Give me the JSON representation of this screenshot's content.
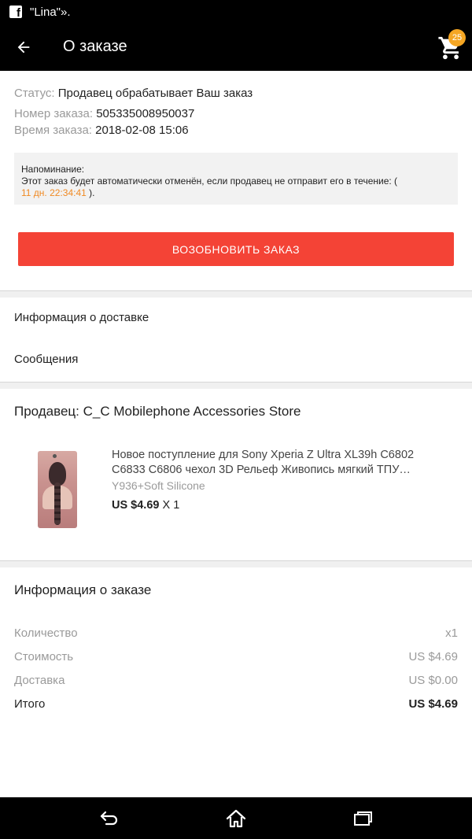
{
  "status_bar": {
    "notification_text": "\"Lina\"»."
  },
  "app_bar": {
    "title": "О заказе",
    "cart_count": "25"
  },
  "order": {
    "status_label": "Статус:",
    "status_value": "Продавец обрабатывает Ваш заказ",
    "number_label": "Номер заказа:",
    "number_value": "505335008950037",
    "time_label": "Время заказа:",
    "time_value": "2018-02-08 15:06",
    "reminder_title": "Напоминание:",
    "reminder_text": "Этот заказ будет автоматически отменён, если продавец не отправит его в течение: (",
    "reminder_time": "11 дн. 22:34:41",
    "reminder_end": ").",
    "renew_button": "Возобновить заказ"
  },
  "menu": {
    "delivery": "Информация о доставке",
    "messages": "Сообщения"
  },
  "seller": {
    "title": "Продавец: C_C Mobilephone Accessories Store",
    "product": {
      "title": "Новое поступление для Sony Xperia Z Ultra XL39h C6802 C6833 C6806 чехол 3D Рельеф Живопись мягкий ТПУ силиконовый",
      "variant": "Y936+Soft Silicone",
      "price": "US $4.69",
      "quantity": "X 1"
    }
  },
  "order_info": {
    "title": "Информация о заказе",
    "rows": [
      {
        "label": "Количество",
        "value": "x1"
      },
      {
        "label": "Стоимость",
        "value": "US $4.69"
      },
      {
        "label": "Доставка",
        "value": "US $0.00"
      },
      {
        "label": "Итого",
        "value": "US $4.69"
      }
    ]
  },
  "colors": {
    "accent": "#f44336",
    "badge": "#f5a623",
    "timer": "#f08a24"
  }
}
